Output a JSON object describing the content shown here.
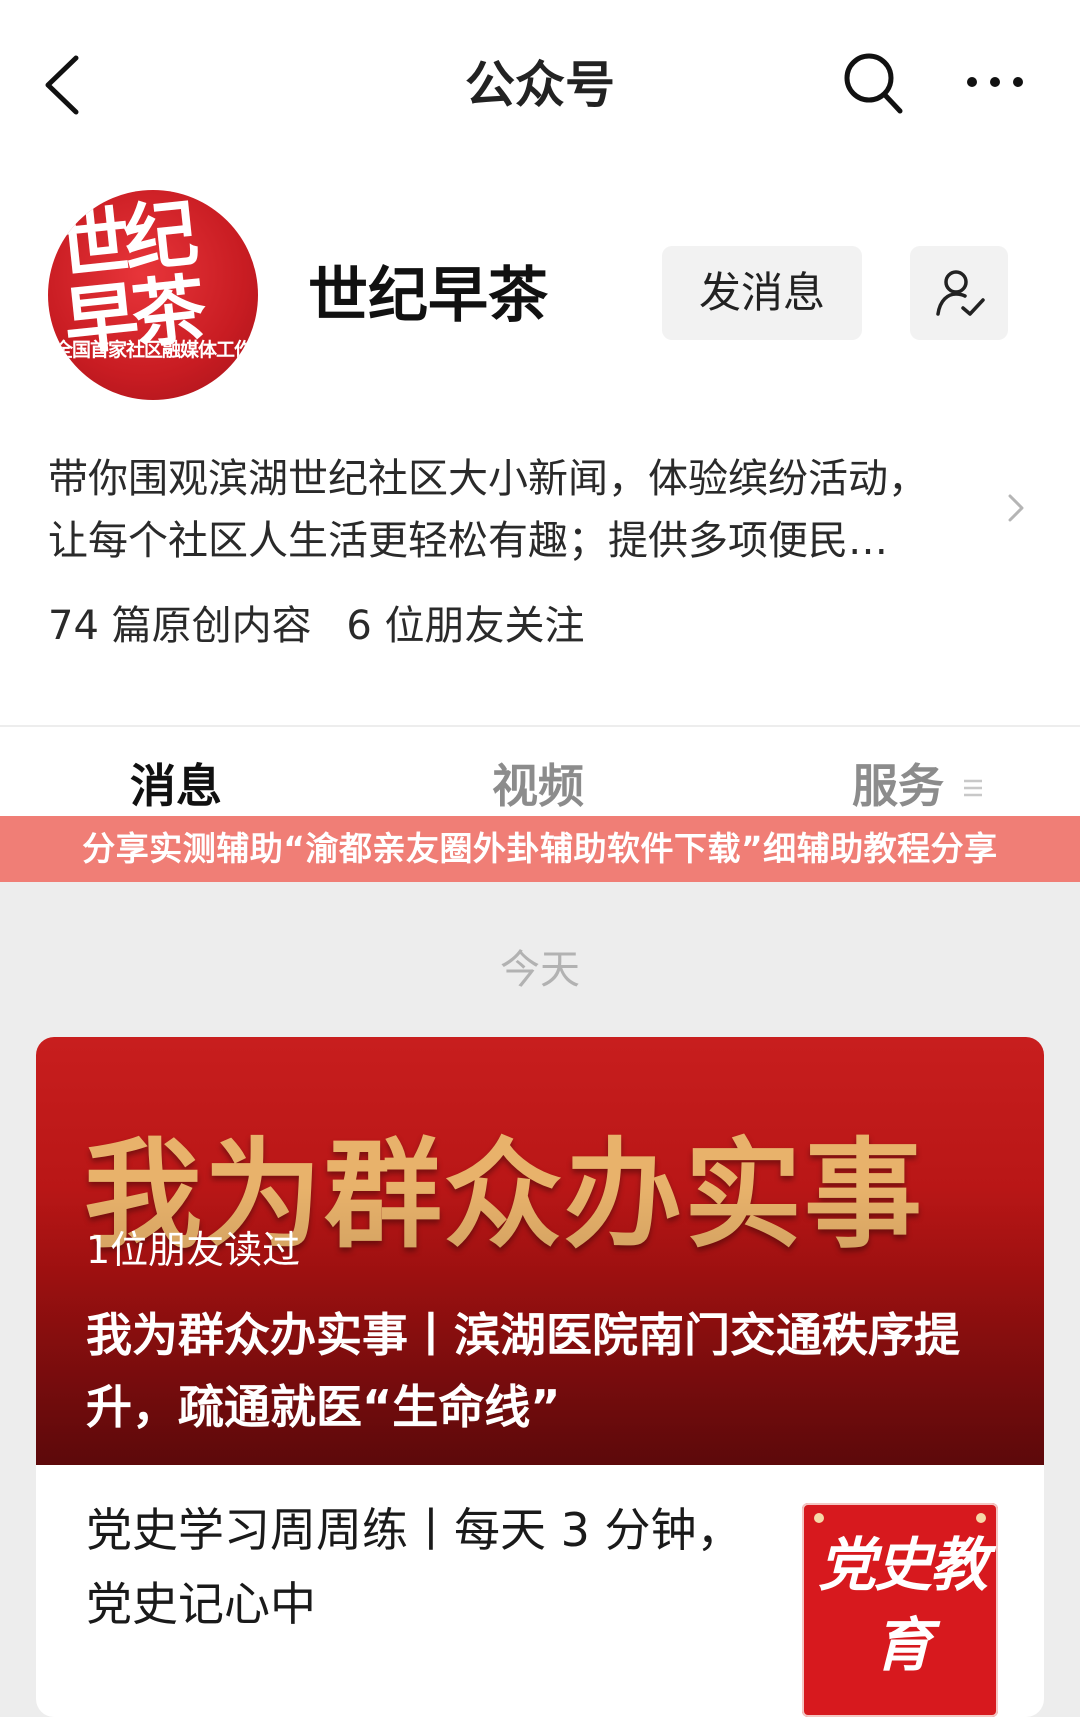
{
  "nav": {
    "title": "公众号"
  },
  "account": {
    "avatar_text_main": "世纪早茶",
    "avatar_text_sub": "全国首家社区融媒体工作室",
    "name": "世纪早茶",
    "message_button": "发消息",
    "description_line1": "带你围观滨湖世纪社区大小新闻，体验缤纷活动，",
    "description_line2": "让每个社区人生活更轻松有趣；提供多项便民…",
    "stats": {
      "original": "74 篇原创内容",
      "friends": "6 位朋友关注"
    }
  },
  "tabs": [
    {
      "label": "消息",
      "active": true
    },
    {
      "label": "视频",
      "active": false
    },
    {
      "label": "服务",
      "active": false
    }
  ],
  "banner": {
    "text": "分享实测辅助“渝都亲友圈外卦辅助软件下载”细辅助教程分享",
    "color": "#f07e76"
  },
  "feed": {
    "date_label": "今天",
    "hero": {
      "image_text": "我为群众办实事",
      "readers": "1位朋友读过",
      "title": "我为群众办实事丨滨湖医院南门交通秩序提升，疏通就医“生命线”"
    },
    "item": {
      "title": "党史学习周周练丨每天 3 分钟，党史记心中",
      "thumb_text": "党史教育"
    }
  },
  "icons": {
    "back": "chevron-left-icon",
    "search": "search-icon",
    "more": "more-dots-icon",
    "follow": "user-check-icon",
    "expand": "chevron-right-icon"
  }
}
